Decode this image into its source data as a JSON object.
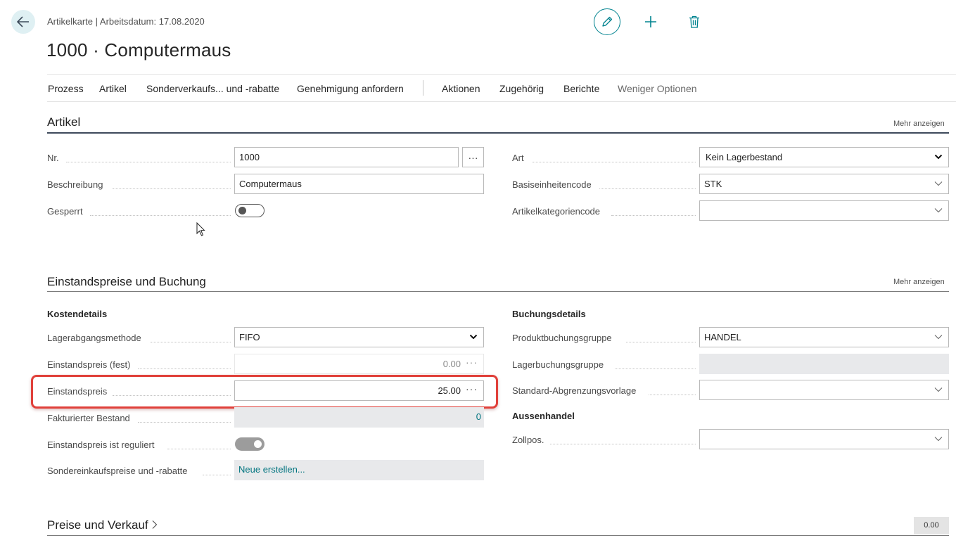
{
  "header": {
    "breadcrumb": "Artikelkarte | Arbeitsdatum: 17.08.2020",
    "title": "1000 · Computermaus"
  },
  "icons": {
    "back": "arrow-left-icon",
    "edit": "pencil-icon",
    "new": "plus-icon",
    "delete": "trash-icon",
    "accent_color": "#00838f"
  },
  "actionbar": {
    "items": [
      "Prozess",
      "Artikel",
      "Sonderverkaufs... und -rabatte",
      "Genehmigung anfordern",
      "Aktionen",
      "Zugehörig",
      "Berichte",
      "Weniger Optionen"
    ]
  },
  "artikel": {
    "title": "Artikel",
    "more": "Mehr anzeigen",
    "nr_label": "Nr.",
    "nr_value": "1000",
    "beschreibung_label": "Beschreibung",
    "beschreibung_value": "Computermaus",
    "gesperrt_label": "Gesperrt",
    "gesperrt_on": false,
    "art_label": "Art",
    "art_value": "Kein Lagerbestand",
    "basis_label": "Basiseinheitencode",
    "basis_value": "STK",
    "kategorie_label": "Artikelkategoriencode",
    "kategorie_value": ""
  },
  "einstand": {
    "title": "Einstandspreise und Buchung",
    "more": "Mehr anzeigen",
    "kosten_head": "Kostendetails",
    "lagerabgang_label": "Lagerabgangsmethode",
    "lagerabgang_value": "FIFO",
    "fest_label": "Einstandspreis (fest)",
    "fest_value": "0.00",
    "preis_label": "Einstandspreis",
    "preis_value": "25.00",
    "fakt_label": "Fakturierter Bestand",
    "fakt_value": "0",
    "reguliert_label": "Einstandspreis ist reguliert",
    "reguliert_on": true,
    "sonder_label": "Sondereinkaufspreise und -rabatte",
    "sonder_value": "Neue erstellen...",
    "buchung_head": "Buchungsdetails",
    "produkt_label": "Produktbuchungsgruppe",
    "produkt_value": "HANDEL",
    "lager_label": "Lagerbuchungsgruppe",
    "lager_value": "",
    "standard_label": "Standard-Abgrenzungsvorlage",
    "standard_value": "",
    "aussen_head": "Aussenhandel",
    "zoll_label": "Zollpos.",
    "zoll_value": ""
  },
  "preise": {
    "title": "Preise und Verkauf",
    "badge": "0.00"
  }
}
